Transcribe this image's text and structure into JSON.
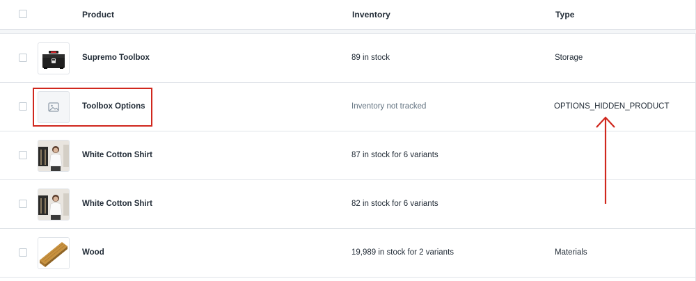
{
  "header": {
    "product_label": "Product",
    "inventory_label": "Inventory",
    "type_label": "Type"
  },
  "rows": [
    {
      "name": "Supremo Toolbox",
      "inventory": "89 in stock",
      "type": "Storage",
      "thumb": "toolbox-image"
    },
    {
      "name": "Toolbox Options",
      "inventory": "Inventory not tracked",
      "type": "OPTIONS_HIDDEN_PRODUCT",
      "thumb": "image-placeholder-icon"
    },
    {
      "name": "White Cotton Shirt",
      "inventory": "87 in stock for 6 variants",
      "type": "",
      "thumb": "shirt-photo"
    },
    {
      "name": "White Cotton Shirt",
      "inventory": "82 in stock for 6 variants",
      "type": "",
      "thumb": "shirt-photo"
    },
    {
      "name": "Wood",
      "inventory": "19,989 in stock for 2 variants",
      "type": "Materials",
      "thumb": "wood-plank-image"
    }
  ],
  "colors": {
    "annotation_red": "#d0271d",
    "border": "#dfe3e8",
    "muted_text": "#637381"
  }
}
